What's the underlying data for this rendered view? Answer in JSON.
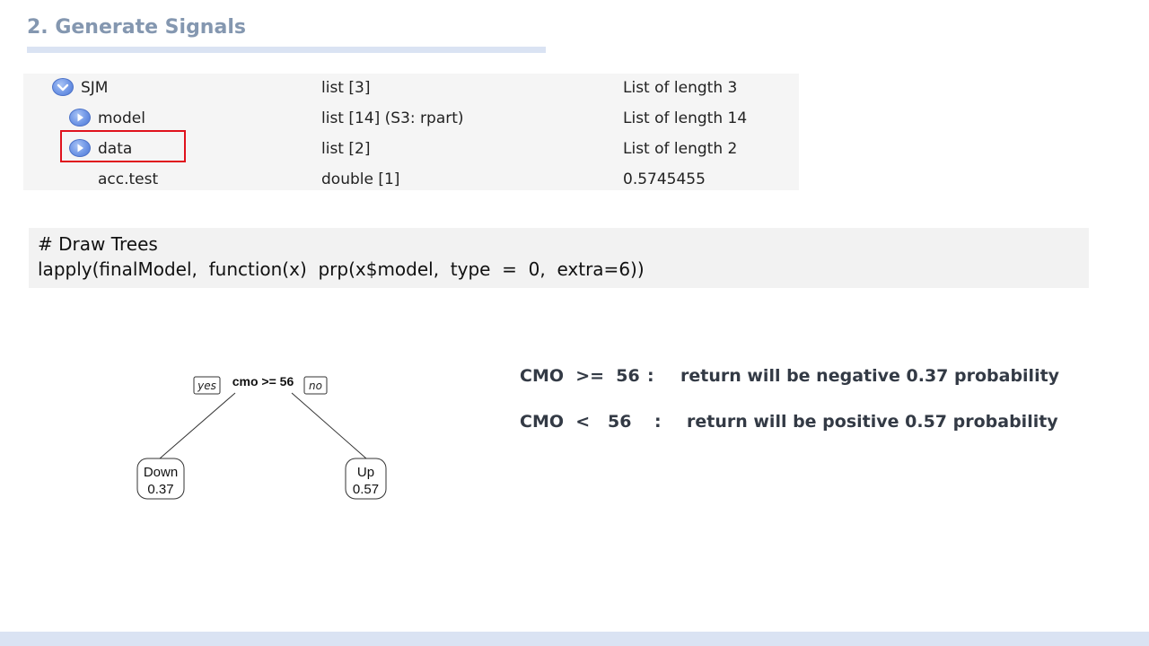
{
  "slide": {
    "title": "2. Generate Signals"
  },
  "environment": {
    "rows": [
      {
        "name": "SJM",
        "type": "list [3]",
        "value": "List of length 3",
        "icon": "chevron-down-circle-icon"
      },
      {
        "name": "model",
        "type": "list [14] (S3: rpart)",
        "value": "List of length 14",
        "icon": "play-circle-icon"
      },
      {
        "name": "data",
        "type": "list [2]",
        "value": "List of length 2",
        "icon": "play-circle-icon"
      },
      {
        "name": "acc.test",
        "type": "double [1]",
        "value": "0.5745455"
      }
    ],
    "highlight_color": "#e0121d"
  },
  "code": {
    "line1": "# Draw Trees",
    "line2": "lapply(finalModel,  function(x)  prp(x$model,  type  =  0,  extra=6))"
  },
  "tree": {
    "root_split": "cmo >= 56",
    "yes_label": "yes",
    "no_label": "no",
    "left_leaf": {
      "class": "Down",
      "prob": "0.37"
    },
    "right_leaf": {
      "class": "Up",
      "prob": "0.57"
    }
  },
  "rules": {
    "rule1": {
      "condition": "CMO  >=  56",
      "sep": ":",
      "text": "return will be negative 0.37 probability"
    },
    "rule2": {
      "condition": "CMO  <   56",
      "sep": ":",
      "text": "return will be positive 0.57 probability"
    }
  },
  "colors": {
    "title": "#8497b0",
    "accent_bar": "#dae3f3",
    "panel_bg": "#f5f5f5",
    "code_bg": "#f2f2f2",
    "icon_blue": "#6f96e6"
  }
}
